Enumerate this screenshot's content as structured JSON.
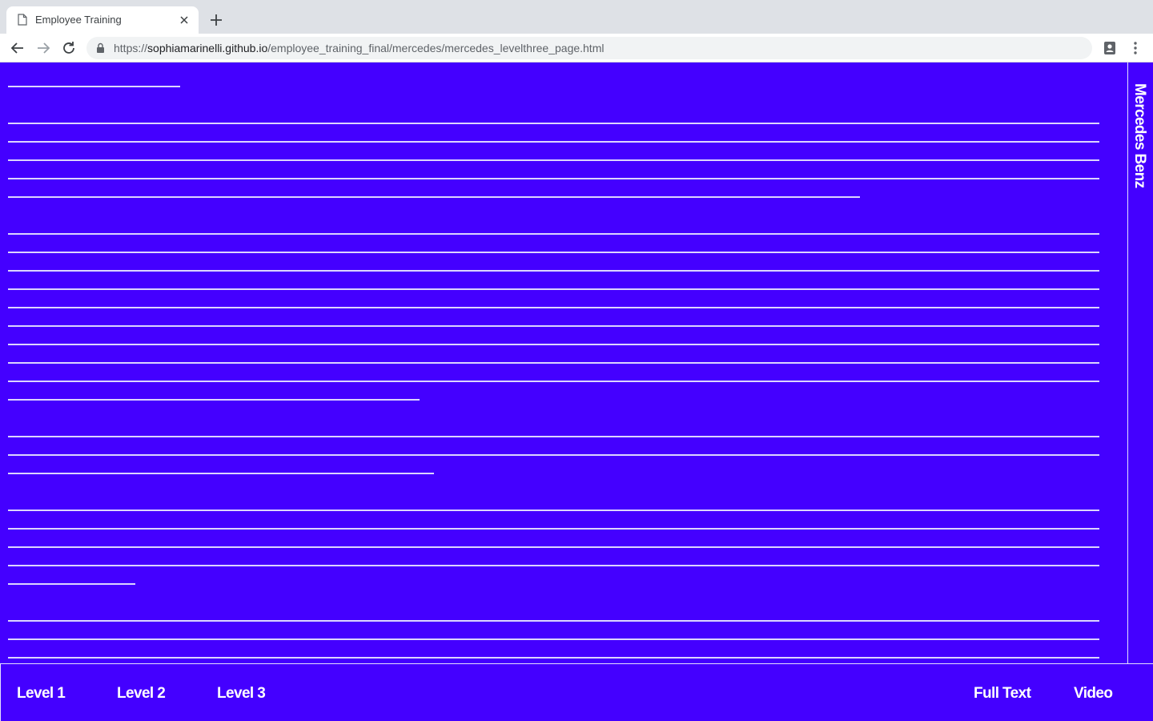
{
  "browser": {
    "tab": {
      "title": "Employee Training",
      "favicon": "page-icon",
      "close_icon": "close-icon"
    },
    "new_tab_icon": "plus-icon",
    "nav": {
      "back_icon": "arrow-left-icon",
      "forward_icon": "arrow-right-icon",
      "reload_icon": "reload-icon"
    },
    "address_bar": {
      "lock_icon": "lock-icon",
      "scheme": "https://",
      "host": "sophiamarinelli.github.io",
      "path": "/employee_training_final/mercedes/mercedes_levelthree_page.html"
    },
    "profile_icon": "profile-icon",
    "menu_icon": "kebab-menu-icon"
  },
  "page": {
    "background_color": "#4400ff",
    "text_color": "#ffffff",
    "side_title": "Mercedes Benz",
    "bottom_nav": {
      "level1": "Level 1",
      "level2": "Level 2",
      "level3": "Level 3",
      "full_text": "Full Text",
      "video": "Video"
    },
    "content_note_lines": "text rendered as horizontal strike lines (redacted)"
  }
}
